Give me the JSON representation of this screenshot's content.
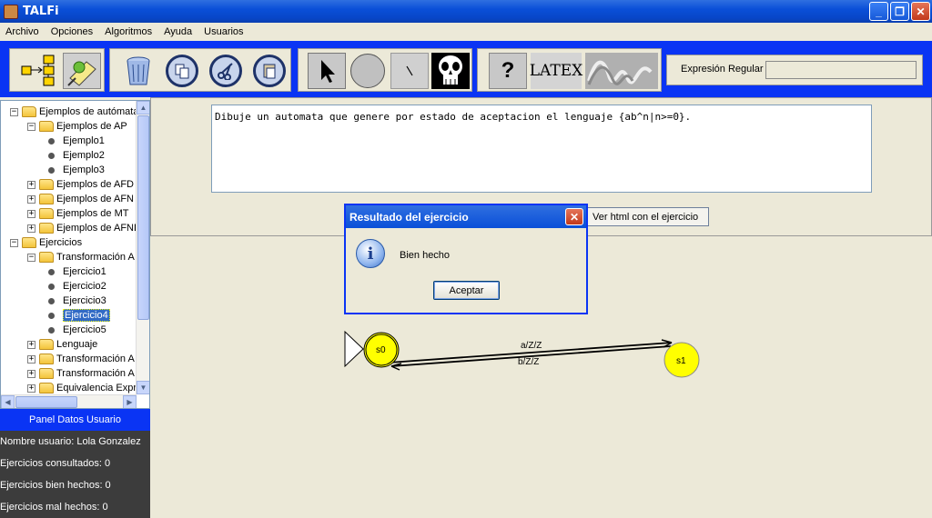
{
  "window": {
    "title": "TALFi",
    "minimize": "_",
    "maximize": "❐",
    "close": "✕"
  },
  "menu": [
    "Archivo",
    "Opciones",
    "Algoritmos",
    "Ayuda",
    "Usuarios"
  ],
  "toolbar": {
    "help_symbol": "?",
    "latex_label": "LATEX",
    "regex_label": "Expresión Regular",
    "regex_value": "",
    "icons": [
      "automaton-to-regex-icon",
      "notes-icon",
      "trash-icon",
      "copy-icon",
      "cut-icon",
      "paste-icon",
      "pointer-icon",
      "state-circle-icon",
      "transition-line-icon",
      "skull-icon",
      "help-icon",
      "latex-icon",
      "wave-icon"
    ]
  },
  "tree": {
    "items": [
      {
        "label": "Ejemplos de autómata",
        "level": 0,
        "type": "folder",
        "expanded": true
      },
      {
        "label": "Ejemplos de AP",
        "level": 1,
        "type": "folder",
        "expanded": true
      },
      {
        "label": "Ejemplo1",
        "level": 2,
        "type": "leaf"
      },
      {
        "label": "Ejemplo2",
        "level": 2,
        "type": "leaf"
      },
      {
        "label": "Ejemplo3",
        "level": 2,
        "type": "leaf"
      },
      {
        "label": "Ejemplos de AFD",
        "level": 1,
        "type": "folder",
        "expanded": false
      },
      {
        "label": "Ejemplos de AFN",
        "level": 1,
        "type": "folder",
        "expanded": false
      },
      {
        "label": "Ejemplos de MT",
        "level": 1,
        "type": "folder",
        "expanded": false
      },
      {
        "label": "Ejemplos de AFND",
        "level": 1,
        "type": "folder",
        "expanded": false
      },
      {
        "label": "Ejercicios",
        "level": 0,
        "type": "folder",
        "expanded": true
      },
      {
        "label": "Transformación A",
        "level": 1,
        "type": "folder",
        "expanded": true
      },
      {
        "label": "Ejercicio1",
        "level": 2,
        "type": "leaf"
      },
      {
        "label": "Ejercicio2",
        "level": 2,
        "type": "leaf"
      },
      {
        "label": "Ejercicio3",
        "level": 2,
        "type": "leaf"
      },
      {
        "label": "Ejercicio4",
        "level": 2,
        "type": "leaf",
        "selected": true
      },
      {
        "label": "Ejercicio5",
        "level": 2,
        "type": "leaf"
      },
      {
        "label": "Lenguaje",
        "level": 1,
        "type": "folder",
        "expanded": false
      },
      {
        "label": "Transformación A",
        "level": 1,
        "type": "folder",
        "expanded": false
      },
      {
        "label": "Transformación A",
        "level": 1,
        "type": "folder",
        "expanded": false
      },
      {
        "label": "Equivalencia Expr",
        "level": 1,
        "type": "folder",
        "expanded": false
      }
    ]
  },
  "user_panel": {
    "header": "Panel Datos Usuario",
    "user_name": "Nombre usuario: Lola Gonzalez",
    "consulted": "Ejercicios consultados: 0",
    "correct": "Ejercicios bien hechos: 0",
    "wrong": "Ejercicios mal hechos: 0"
  },
  "exercise": {
    "statement": "Dibuje un automata que genere por estado de aceptacion el lenguaje {ab^n|n>=0}.",
    "html_button": "Ver html con el ejercicio"
  },
  "dialog": {
    "title": "Resultado del ejercicio",
    "message": "Bien hecho",
    "accept": "Aceptar",
    "close": "✕",
    "icon_symbol": "i"
  },
  "automaton": {
    "states": [
      "s0",
      "s1"
    ],
    "initial": "s0",
    "transitions": [
      {
        "from": "s0",
        "to": "s1",
        "label": "a/Z/Z"
      },
      {
        "from": "s1",
        "to": "s0",
        "label": "b/Z/Z"
      }
    ]
  },
  "colors": {
    "toolbar_bg": "#0a34f4",
    "state_fill": "#ffff00",
    "selection": "#316ac5"
  }
}
